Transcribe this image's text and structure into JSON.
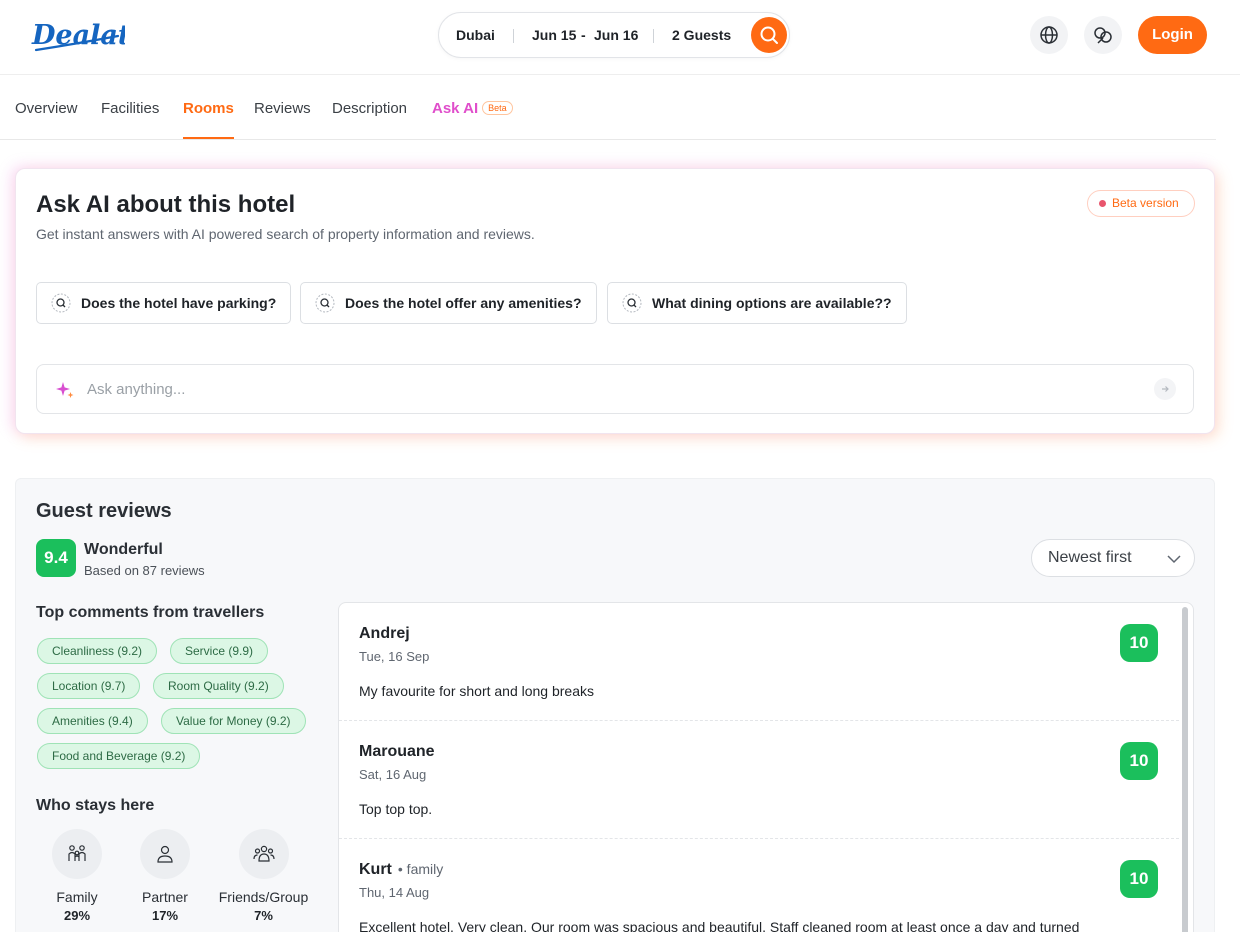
{
  "brand": {
    "name": "Dealato",
    "color": "#1565c0"
  },
  "search": {
    "destination": "Dubai",
    "check_in": "Jun 15",
    "date_separator": "-",
    "check_out": "Jun 16",
    "guests": "2 Guests"
  },
  "header": {
    "login_label": "Login",
    "accent": "#ff6a13"
  },
  "tabs": [
    {
      "label": "Overview"
    },
    {
      "label": "Facilities"
    },
    {
      "label": "Rooms",
      "active": true
    },
    {
      "label": "Reviews"
    },
    {
      "label": "Description"
    },
    {
      "label": "Ask AI",
      "badge": "Beta"
    }
  ],
  "ask_ai": {
    "title": "Ask AI about this hotel",
    "subtitle": "Get instant answers with AI powered search of property information and reviews.",
    "beta_label": "Beta version",
    "suggestions": [
      "Does the hotel have parking?",
      "Does the hotel offer any amenities?",
      "What dining options are available??"
    ],
    "input_placeholder": "Ask anything..."
  },
  "reviews": {
    "title": "Guest reviews",
    "score": "9.4",
    "score_label": "Wonderful",
    "based_on": "Based on 87 reviews",
    "sort_value": "Newest first",
    "top_comments_heading": "Top comments from travellers",
    "tags": [
      "Cleanliness (9.2)",
      "Service (9.9)",
      "Location (9.7)",
      "Room Quality (9.2)",
      "Amenities (9.4)",
      "Value for Money (9.2)",
      "Food and Beverage (9.2)"
    ],
    "who_stays_heading": "Who stays here",
    "who_stays": [
      {
        "label": "Family",
        "percent": "29%",
        "icon": "family-icon"
      },
      {
        "label": "Partner",
        "percent": "17%",
        "icon": "person-icon"
      },
      {
        "label": "Friends/Group",
        "percent": "7%",
        "icon": "group-icon"
      }
    ],
    "items": [
      {
        "name": "Andrej",
        "trip": "",
        "date": "Tue, 16 Sep",
        "text": "My favourite for short and long breaks",
        "score": "10"
      },
      {
        "name": "Marouane",
        "trip": "",
        "date": "Sat, 16 Aug",
        "text": "Top top top.",
        "score": "10"
      },
      {
        "name": "Kurt",
        "trip": "• family",
        "date": "Thu, 14 Aug",
        "text": "Excellent hotel. Very clean. Our room was spacious and beautiful. Staff cleaned room at least once a day and turned",
        "score": "10"
      }
    ],
    "score_color": "#1bbf5c"
  }
}
